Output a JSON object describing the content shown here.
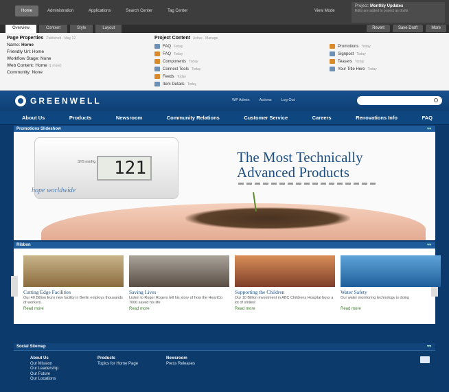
{
  "admin_bar": {
    "nav": [
      "Home",
      "Administration",
      "Applications",
      "Search Center",
      "Tag Center"
    ],
    "view_mode": "View Mode",
    "project_label": "Project:",
    "project_name": "Monthly Updates",
    "project_note": "Edits are added to project as drafts"
  },
  "sub_bar": {
    "tabs": [
      "Overview",
      "Content",
      "Style",
      "Layout"
    ],
    "actions": [
      "Revert",
      "Save Draft",
      "More"
    ]
  },
  "page_properties": {
    "title": "Page Properties",
    "status": "Published · May 12",
    "name_label": "Name:",
    "name_value": "Home",
    "friendly_url": "Friendly Url: Home",
    "workflow": "Workflow Stage: None",
    "web_content_label": "Web Content: Home",
    "web_content_more": "(1 more)",
    "community": "Community: None"
  },
  "project_content": {
    "title": "Project Content",
    "actions": "Active · Manage",
    "col1": [
      {
        "label": "FAQ",
        "when": "Today",
        "icon": "page-icon"
      },
      {
        "label": "FAQ",
        "when": "Today",
        "icon": "web-content-icon"
      },
      {
        "label": "Components",
        "when": "Today",
        "icon": "web-content-icon"
      },
      {
        "label": "Connect Tools",
        "when": "Today",
        "icon": "page-icon"
      },
      {
        "label": "Feeds",
        "when": "Today",
        "icon": "web-content-icon"
      },
      {
        "label": "Item Details",
        "when": "Today",
        "icon": "page-icon"
      }
    ],
    "col2": [
      {
        "label": "Promotions",
        "when": "Today",
        "icon": "web-content-icon"
      },
      {
        "label": "Signpost",
        "when": "Today",
        "icon": "page-icon"
      },
      {
        "label": "Teasers",
        "when": "Today",
        "icon": "web-content-icon"
      },
      {
        "label": "Your Title Here",
        "when": "Today",
        "icon": "page-icon"
      }
    ]
  },
  "site": {
    "brand": "GREENWELL",
    "header_links": [
      "WP Admin",
      "Actions",
      "Log Out"
    ],
    "menu": [
      "About Us",
      "Products",
      "Newsroom",
      "Community Relations",
      "Customer Service",
      "Careers",
      "Renovations Info",
      "FAQ"
    ],
    "slideshow": {
      "title": "Promotions Slideshow",
      "device_label": "SYS mmHg",
      "device_reading": "121",
      "tagline": "hope worldwide",
      "headline_line1": "The Most Technically",
      "headline_line2": "Advanced Products"
    },
    "ribbon": {
      "title": "Ribbon",
      "cards": [
        {
          "title": "Cutting Edge Facilities",
          "desc": "Our 40 Billion Euro new facility in Berlin employs thousands of workers.",
          "more": "Read more"
        },
        {
          "title": "Saving Lives",
          "desc": "Listen to Roger Rogers tell his story of how the HeartCo 7000 saved his life",
          "more": "Read more"
        },
        {
          "title": "Supporting the Children",
          "desc": "Our 10 Billion investment in ABC Childrens Hospital buys a lot of smiles!",
          "more": "Read more"
        },
        {
          "title": "Water Safety",
          "desc": "Our water monitoring technology is doing",
          "more": "Read more"
        }
      ]
    },
    "social": {
      "title": "Social Sitemap",
      "about": [
        "About Us",
        "Our Mission",
        "Our Leadership",
        "Our Future",
        "Our Locations"
      ],
      "products": [
        "Products",
        "Topics for Home Page"
      ],
      "newsroom": [
        "Newsroom",
        "Press Releases"
      ]
    }
  }
}
